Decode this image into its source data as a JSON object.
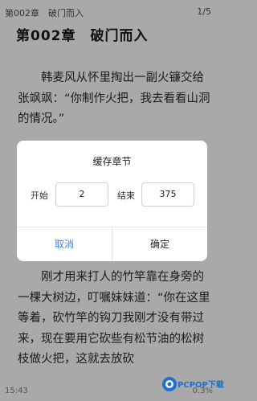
{
  "header": {
    "chapter_label": "第002章　破门而入",
    "page_indicator": "1/5"
  },
  "content": {
    "chapter_title": "第002章　破门而入",
    "paragraph_1": "韩麦风从怀里掏出一副火镰交给张飒飒：“你制作火把，我去看看山洞的情况。”",
    "paragraph_2": "刚才用来打人的竹竿靠在身旁的一棵大树边，叮嘱妹妹道：“你在这里等着，砍竹竿的钩刀我刚才没有带过来，现在要用它砍些有松节油的松树枝做火把，这就去放砍"
  },
  "dialog": {
    "title": "缓存章节",
    "start_label": "开始",
    "start_value": "2",
    "end_label": "结束",
    "end_value": "375",
    "cancel_label": "取消",
    "confirm_label": "确定"
  },
  "footer": {
    "time": "15:43",
    "progress": "0.3%"
  },
  "watermark": {
    "text": "PCPOP下载"
  },
  "colors": {
    "background_dimmed": "#a9a9a9",
    "cancel_blue": "#3f7fdc",
    "watermark_blue": "#1e6fd0"
  }
}
